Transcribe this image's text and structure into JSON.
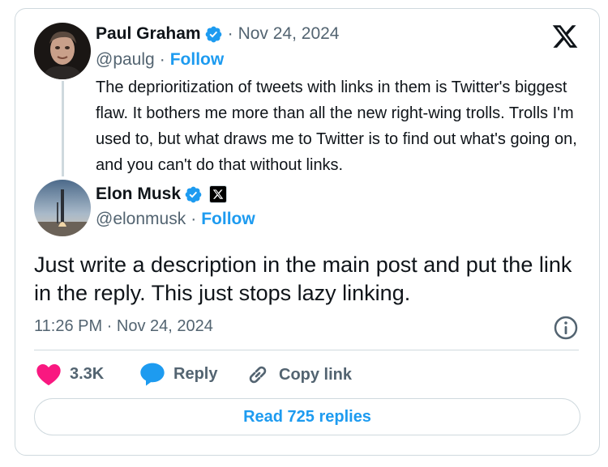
{
  "quoted_post": {
    "author_name": "Paul Graham",
    "date": "Nov 24, 2024",
    "handle": "@paulg",
    "follow_label": "Follow",
    "text": "The deprioritization of tweets with links in them is Twitter's biggest flaw. It bothers me more than all the new right-wing trolls. Trolls I'm used to, but what draws me to Twitter is to find out what's going on, and you can't do that without links."
  },
  "reply_post": {
    "author_name": "Elon Musk",
    "handle": "@elonmusk",
    "follow_label": "Follow",
    "text": "Just write a description in the main post and put the link in the reply. This just stops lazy linking.",
    "timestamp": "11:26 PM · Nov 24, 2024"
  },
  "actions": {
    "like_count": "3.3K",
    "reply_label": "Reply",
    "copy_link_label": "Copy link"
  },
  "read_replies_label": "Read 725 replies",
  "separator": "·",
  "colors": {
    "accent": "#1d9bf0",
    "like": "#f91880",
    "secondary_text": "#536471",
    "border": "#cfd9de"
  },
  "icons": {
    "brand": "x-logo-icon",
    "verified": "verified-badge-icon",
    "info": "info-icon",
    "like": "heart-icon",
    "reply": "reply-bubble-icon",
    "copy_link": "link-icon"
  }
}
